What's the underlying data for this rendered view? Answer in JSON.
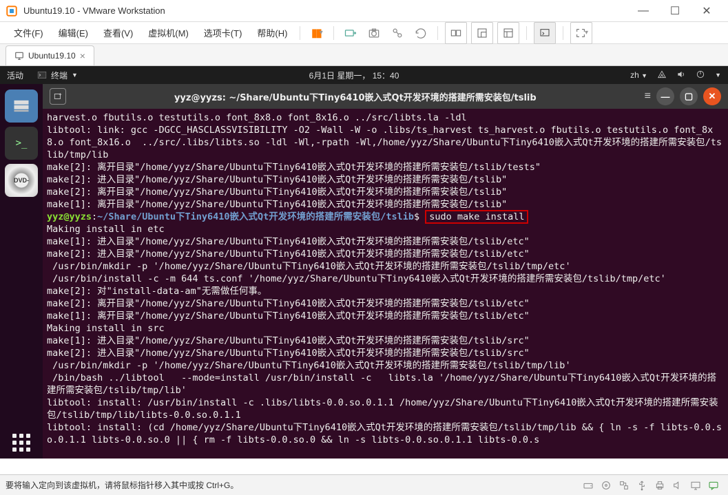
{
  "window": {
    "title": "Ubuntu19.10 - VMware Workstation"
  },
  "menubar": {
    "items": [
      "文件(F)",
      "编辑(E)",
      "查看(V)",
      "虚拟机(M)",
      "选项卡(T)",
      "帮助(H)"
    ]
  },
  "tab": {
    "label": "Ubuntu19.10"
  },
  "topbar": {
    "activities": "活动",
    "app": "终端",
    "clock": "6月1日 星期一， 15：40",
    "lang": "zh"
  },
  "dock": {
    "dvd_label": "DVD-"
  },
  "terminal": {
    "title": "yyz@yyzs: ~/Share/Ubuntu下Tiny6410嵌入式Qt开发环境的搭建所需安装包/tslib",
    "lines": [
      "harvest.o fbutils.o testutils.o font_8x8.o font_8x16.o ../src/libts.la -ldl",
      "libtool: link: gcc -DGCC_HASCLASSVISIBILITY -O2 -Wall -W -o .libs/ts_harvest ts_harvest.o fbutils.o testutils.o font_8x8.o font_8x16.o  ../src/.libs/libts.so -ldl -Wl,-rpath -Wl,/home/yyz/Share/Ubuntu下Tiny6410嵌入式Qt开发环境的搭建所需安装包/tslib/tmp/lib",
      "make[2]: 离开目录\"/home/yyz/Share/Ubuntu下Tiny6410嵌入式Qt开发环境的搭建所需安装包/tslib/tests\"",
      "make[2]: 进入目录\"/home/yyz/Share/Ubuntu下Tiny6410嵌入式Qt开发环境的搭建所需安装包/tslib\"",
      "make[2]: 离开目录\"/home/yyz/Share/Ubuntu下Tiny6410嵌入式Qt开发环境的搭建所需安装包/tslib\"",
      "make[1]: 离开目录\"/home/yyz/Share/Ubuntu下Tiny6410嵌入式Qt开发环境的搭建所需安装包/tslib\""
    ],
    "prompt": {
      "user": "yyz@yyzs",
      "sep": ":",
      "path": "~/Share/Ubuntu下Tiny6410嵌入式Qt开发环境的搭建所需安装包/tslib",
      "dollar": "$",
      "cmd": "sudo make install"
    },
    "lines2": [
      "Making install in etc",
      "make[1]: 进入目录\"/home/yyz/Share/Ubuntu下Tiny6410嵌入式Qt开发环境的搭建所需安装包/tslib/etc\"",
      "make[2]: 进入目录\"/home/yyz/Share/Ubuntu下Tiny6410嵌入式Qt开发环境的搭建所需安装包/tslib/etc\"",
      " /usr/bin/mkdir -p '/home/yyz/Share/Ubuntu下Tiny6410嵌入式Qt开发环境的搭建所需安装包/tslib/tmp/etc'",
      " /usr/bin/install -c -m 644 ts.conf '/home/yyz/Share/Ubuntu下Tiny6410嵌入式Qt开发环境的搭建所需安装包/tslib/tmp/etc'",
      "make[2]: 对\"install-data-am\"无需做任何事。",
      "make[2]: 离开目录\"/home/yyz/Share/Ubuntu下Tiny6410嵌入式Qt开发环境的搭建所需安装包/tslib/etc\"",
      "make[1]: 离开目录\"/home/yyz/Share/Ubuntu下Tiny6410嵌入式Qt开发环境的搭建所需安装包/tslib/etc\"",
      "Making install in src",
      "make[1]: 进入目录\"/home/yyz/Share/Ubuntu下Tiny6410嵌入式Qt开发环境的搭建所需安装包/tslib/src\"",
      "make[2]: 进入目录\"/home/yyz/Share/Ubuntu下Tiny6410嵌入式Qt开发环境的搭建所需安装包/tslib/src\"",
      " /usr/bin/mkdir -p '/home/yyz/Share/Ubuntu下Tiny6410嵌入式Qt开发环境的搭建所需安装包/tslib/tmp/lib'",
      " /bin/bash ../libtool   --mode=install /usr/bin/install -c   libts.la '/home/yyz/Share/Ubuntu下Tiny6410嵌入式Qt开发环境的搭建所需安装包/tslib/tmp/lib'",
      "libtool: install: /usr/bin/install -c .libs/libts-0.0.so.0.1.1 /home/yyz/Share/Ubuntu下Tiny6410嵌入式Qt开发环境的搭建所需安装包/tslib/tmp/lib/libts-0.0.so.0.1.1",
      "libtool: install: (cd /home/yyz/Share/Ubuntu下Tiny6410嵌入式Qt开发环境的搭建所需安装包/tslib/tmp/lib && { ln -s -f libts-0.0.so.0.1.1 libts-0.0.so.0 || { rm -f libts-0.0.so.0 && ln -s libts-0.0.so.0.1.1 libts-0.0.s"
    ]
  },
  "statusbar": {
    "hint": "要将输入定向到该虚拟机，请将鼠标指针移入其中或按 Ctrl+G。"
  }
}
